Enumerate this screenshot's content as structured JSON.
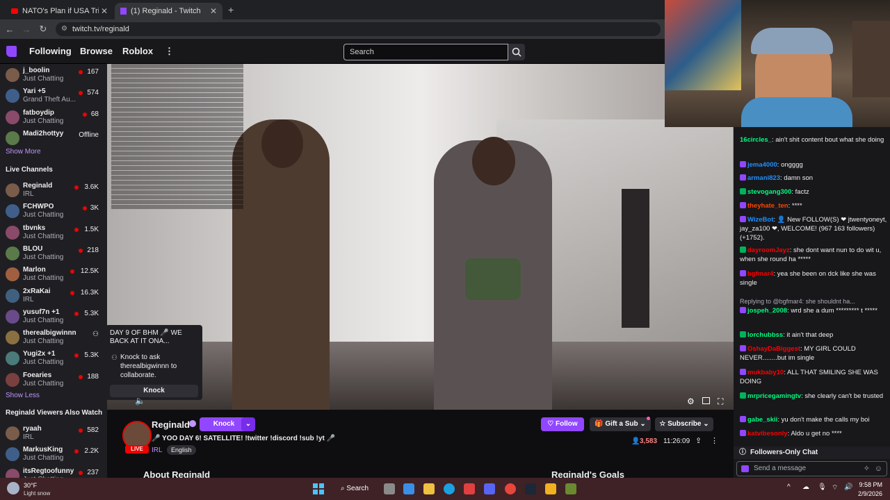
{
  "browser": {
    "tabs": [
      {
        "title": "NATO's Plan if USA Tries to Inv...",
        "active": false
      },
      {
        "title": "(1) Reginald - Twitch",
        "active": true
      }
    ],
    "url": "twitch.tv/reginald"
  },
  "topnav": {
    "following": "Following",
    "browse": "Browse",
    "roblox": "Roblox",
    "search_placeholder": "Search"
  },
  "sidebar": {
    "followed": [
      {
        "name": "j_boolin",
        "category": "Just Chatting",
        "viewers": "167"
      },
      {
        "name": "Yari +5",
        "category": "Grand Theft Au...",
        "viewers": "574"
      },
      {
        "name": "fatboydip",
        "category": "Just Chatting",
        "viewers": "68"
      },
      {
        "name": "Madi2hottyy",
        "category": "",
        "viewers": "Offline"
      }
    ],
    "show_more": "Show More",
    "live_channels_title": "Live Channels",
    "live": [
      {
        "name": "Reginald",
        "category": "IRL",
        "viewers": "3.6K"
      },
      {
        "name": "FCHWPO",
        "category": "Just Chatting",
        "viewers": "3K"
      },
      {
        "name": "tbvnks",
        "category": "Just Chatting",
        "viewers": "1.5K"
      },
      {
        "name": "BLOU",
        "category": "Just Chatting",
        "viewers": "218"
      },
      {
        "name": "Marlon",
        "category": "Just Chatting",
        "viewers": "12.5K"
      },
      {
        "name": "2xRaKai",
        "category": "IRL",
        "viewers": "16.3K"
      },
      {
        "name": "yusuf7n +1",
        "category": "Just Chatting",
        "viewers": "5.3K"
      },
      {
        "name": "therealbigwinnn",
        "category": "Just Chatting",
        "viewers": ""
      },
      {
        "name": "Yugi2x +1",
        "category": "Just Chatting",
        "viewers": "5.3K"
      },
      {
        "name": "Foearies",
        "category": "Just Chatting",
        "viewers": "188"
      }
    ],
    "show_less": "Show Less",
    "also_watch_title": "Reginald Viewers Also Watch",
    "also_watch": [
      {
        "name": "ryaah",
        "category": "IRL",
        "viewers": "582"
      },
      {
        "name": "MarkusKing",
        "category": "Just Chatting",
        "viewers": "2.2K"
      },
      {
        "name": "itsRegtoofunny",
        "category": "Just Chatting",
        "viewers": "237"
      }
    ]
  },
  "knock_popup": {
    "title": "DAY 9 OF BHM 🎤 WE BACK AT IT ONA...",
    "body": "Knock to ask therealbigwinnn to collaborate.",
    "button": "Knock"
  },
  "stream": {
    "channel": "Reginald",
    "knock_label": "Knock",
    "title": "🎤 YOO DAY 6! SATELLITE! !twitter !discord !sub !yt 🎤",
    "live_badge": "LIVE",
    "category": "IRL",
    "tag": "English",
    "follow": "Follow",
    "gift_sub": "Gift a Sub",
    "subscribe": "Subscribe",
    "viewers": "3,583",
    "uptime": "11:26:09",
    "about": "About Reginald",
    "goals": "Reginald's Goals"
  },
  "chat": {
    "messages": [
      {
        "user": "16circles_",
        "text": ": ain't shit content bout what she doing",
        "color": "#00ff7f"
      },
      {
        "user": "jema4000",
        "text": ": ongggg",
        "color": "#1e90ff"
      },
      {
        "user": "armani823",
        "text": ": damn son",
        "color": "#1e90ff"
      },
      {
        "user": "stevogang300",
        "text": ": factz",
        "color": "#00ff7f"
      },
      {
        "user": "theyhate_ten",
        "text": ": ****",
        "color": "#ff4500"
      },
      {
        "user": "WizeBot",
        "text": ": 👤 New FOLLOW(S) ❤ jtwentyoneyt, jay_za100 ❤, WELCOME! (967 163 followers) (+1752).",
        "color": "#1e90ff"
      },
      {
        "user": "dayroomJayz",
        "text": ": she dont want nun to do wit u, when she round ha *****",
        "color": "#ff0000"
      },
      {
        "user": "bgfmar4",
        "text": ": yea she been on dck like she was single",
        "color": "#ff0000"
      },
      {
        "user": "jospeh_2008",
        "text": ": wrd she a dum ********* t *****",
        "color": "#00ff7f",
        "reply": "Replying to @bgfmar4: she shouldnt ha..."
      },
      {
        "user": "lorchubbss",
        "text": ": it ain't that deep",
        "color": "#00ff7f"
      },
      {
        "user": "OshayDaBiggest",
        "text": ": MY GIRL COULD NEVER........but im single",
        "color": "#ff0000"
      },
      {
        "user": "mukbaby10",
        "text": ": ALL THAT SMILING SHE WAS DOING",
        "color": "#ff0000"
      },
      {
        "user": "mrpricegamingtv",
        "text": ": she clearly can't be trusted",
        "color": "#00ff7f"
      },
      {
        "user": "gabe_skii",
        "text": ": yu don't make the calls my boi",
        "color": "#00ff7f"
      },
      {
        "user": "katvibesonly",
        "text": ": Aldo u get no ****",
        "color": "#ff0000"
      }
    ],
    "followers_only": "Followers-Only Chat",
    "send_placeholder": "Send a message"
  },
  "taskbar": {
    "weather_temp": "30°F",
    "weather_desc": "Light snow",
    "search": "Search",
    "time": "9:58 PM",
    "date": "2/9/2026"
  },
  "colors": {
    "twitch_purple": "#9147ff",
    "live_red": "#eb0400",
    "link_purple": "#bf94ff"
  }
}
